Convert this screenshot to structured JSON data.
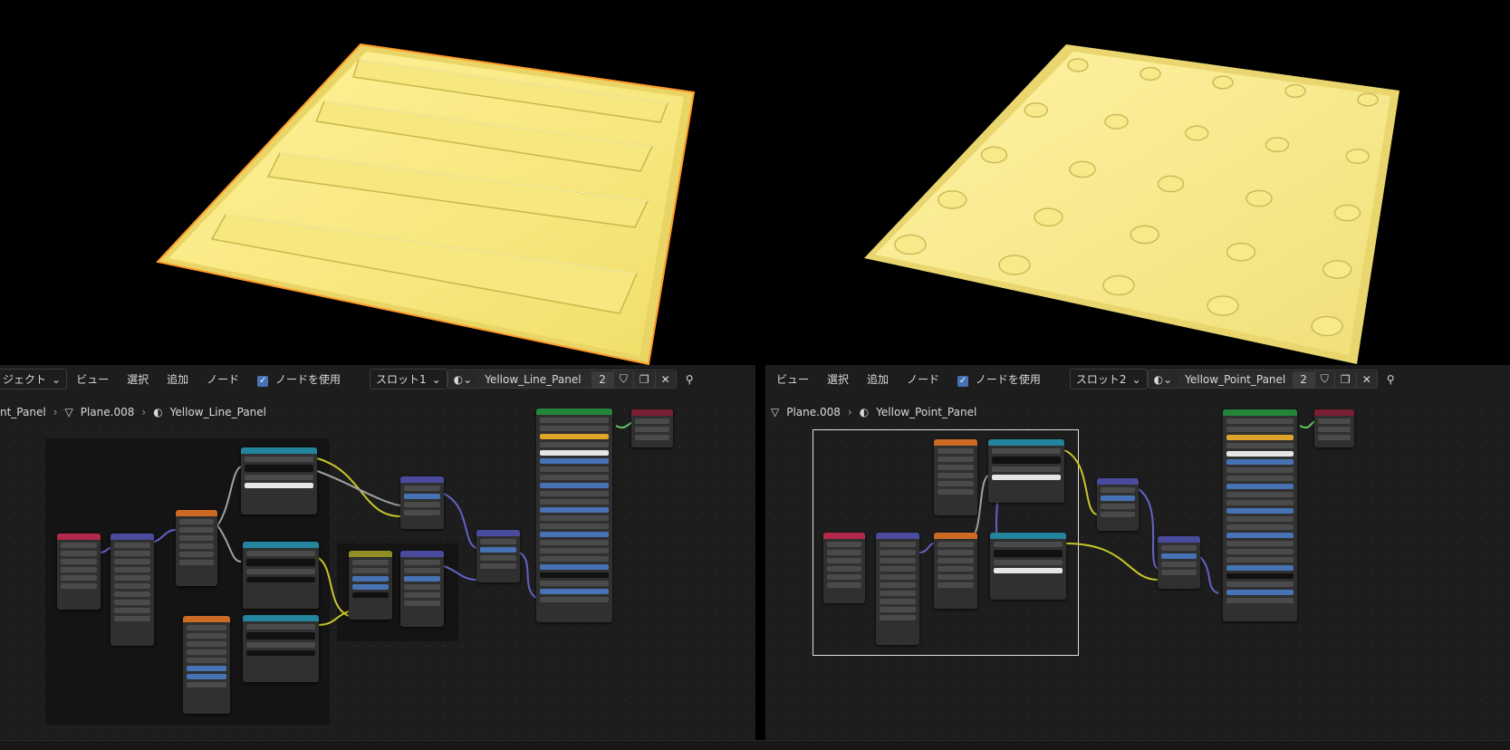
{
  "left_editor": {
    "header": {
      "object_menu": "ジェクト",
      "view": "ビュー",
      "select": "選択",
      "add": "追加",
      "node": "ノード",
      "use_nodes": "ノードを使用",
      "slot": "スロット1",
      "material_name": "Yellow_Line_Panel",
      "user_count": "2"
    },
    "breadcrumb": {
      "object": "nt_Panel",
      "mesh": "Plane.008",
      "material": "Yellow_Line_Panel"
    }
  },
  "right_editor": {
    "header": {
      "view": "ビュー",
      "select": "選択",
      "add": "追加",
      "node": "ノード",
      "use_nodes": "ノードを使用",
      "slot": "スロット2",
      "material_name": "Yellow_Point_Panel",
      "user_count": "2"
    },
    "breadcrumb": {
      "mesh": "Plane.008",
      "material": "Yellow_Point_Panel"
    }
  },
  "icons": [
    "checkbox-icon",
    "material-sphere-icon",
    "shield-icon",
    "duplicate-icon",
    "close-icon",
    "pin-icon",
    "mesh-icon",
    "chevron-down-icon"
  ],
  "colors": {
    "panel_yellow": "#f5e37a",
    "node_bg": "#303030",
    "editor_bg": "#1d1d1d",
    "accent_blue": "#4772b3",
    "wire_yellow": "#c7c729",
    "wire_purple": "#6363c7",
    "wire_gray": "#a1a1a1",
    "wire_green": "#63c763"
  }
}
